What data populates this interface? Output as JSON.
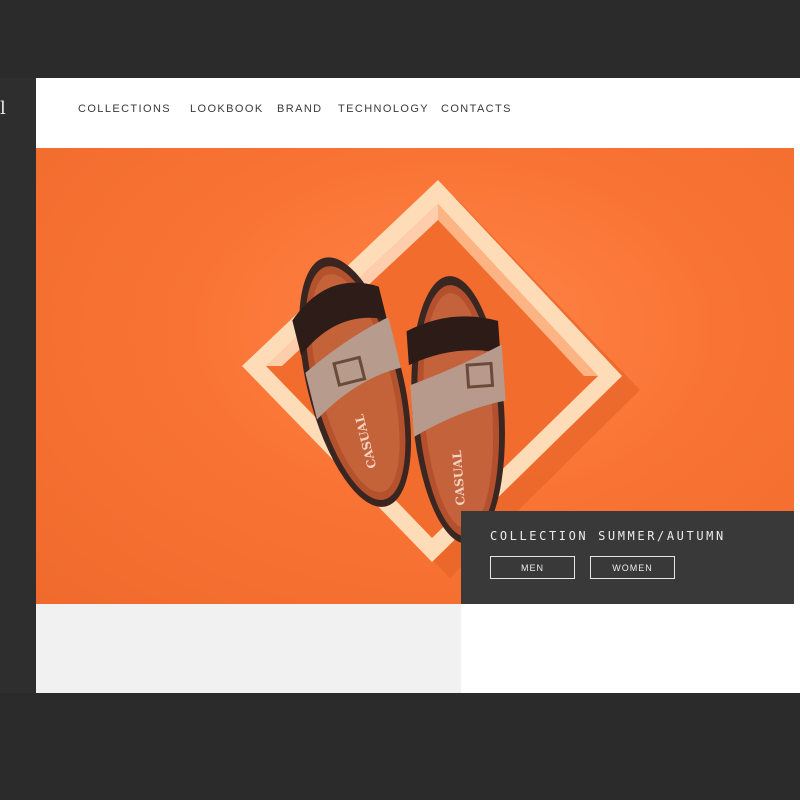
{
  "nav": {
    "items": [
      {
        "label": "COLLECTIONS"
      },
      {
        "label": "LOOKBOOK"
      },
      {
        "label": "BRAND"
      },
      {
        "label": "TECHNOLOGY"
      },
      {
        "label": "CONTACTS"
      }
    ]
  },
  "sidebar": {
    "logo_fragment": "l"
  },
  "hero": {
    "image_alt_brand": "CASUAL",
    "colors": {
      "background": "#f97434",
      "frame": "#ffd9b3",
      "strap_dark": "#3a2722",
      "strap_light": "#b89a8c",
      "sole": "#b8512e"
    }
  },
  "collection": {
    "title": "COLLECTION SUMMER/AUTUMN",
    "buttons": {
      "men": "MEN",
      "women": "WOMEN"
    }
  }
}
